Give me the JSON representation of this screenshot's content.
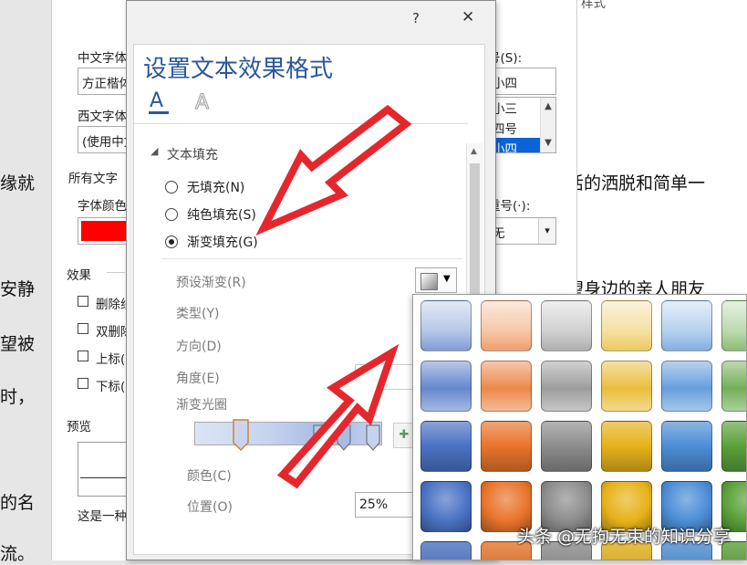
{
  "doc": {
    "lines": [
      "缘就",
      "安静",
      "望被",
      "时，",
      "的名",
      "流。"
    ],
    "right_lines": [
      "活的洒脱和简单一",
      "望身边的亲人朋友"
    ]
  },
  "font_dialog": {
    "top_label": "样式",
    "cn_font_label": "中文字体",
    "cn_font_value": "方正楷体",
    "west_font_label": "西文字体",
    "west_font_value": "(使用中文",
    "size_label": "号(S):",
    "size_items": [
      "小四",
      "小三",
      "四号",
      "小四"
    ],
    "all_text_label": "所有文字",
    "font_color_label": "字体颜色",
    "font_color": "#ff0000",
    "emphasis_label": "重号(·):",
    "emphasis_value": "无",
    "effects_label": "效果",
    "effects": [
      "删除线",
      "双删除",
      "上标(",
      "下标("
    ],
    "preview_label": "预览",
    "preview_note": "这是一种"
  },
  "effects_panel": {
    "help": "?",
    "close": "✕",
    "title": "设置文本效果格式",
    "section": "文本填充",
    "options": [
      {
        "label": "无填充(N)",
        "checked": false
      },
      {
        "label": "纯色填充(S)",
        "checked": false
      },
      {
        "label": "渐变填充(G)",
        "checked": true
      }
    ],
    "preset_label": "预设渐变(R)",
    "type_label": "类型(Y)",
    "direction_label": "方向(D)",
    "angle_label": "角度(E)",
    "stops_label": "渐变光圈",
    "color_label": "颜色(C)",
    "position_label": "位置(O)",
    "position_value": "25%",
    "arrow_color": "#e5272d"
  },
  "gallery": {
    "colors": [
      "#4a72c4",
      "#e8742a",
      "#8c8c8c",
      "#e6b21a",
      "#4c8dd6",
      "#5aa13a"
    ]
  },
  "watermark": "头条 @无拘无束的知识分享"
}
